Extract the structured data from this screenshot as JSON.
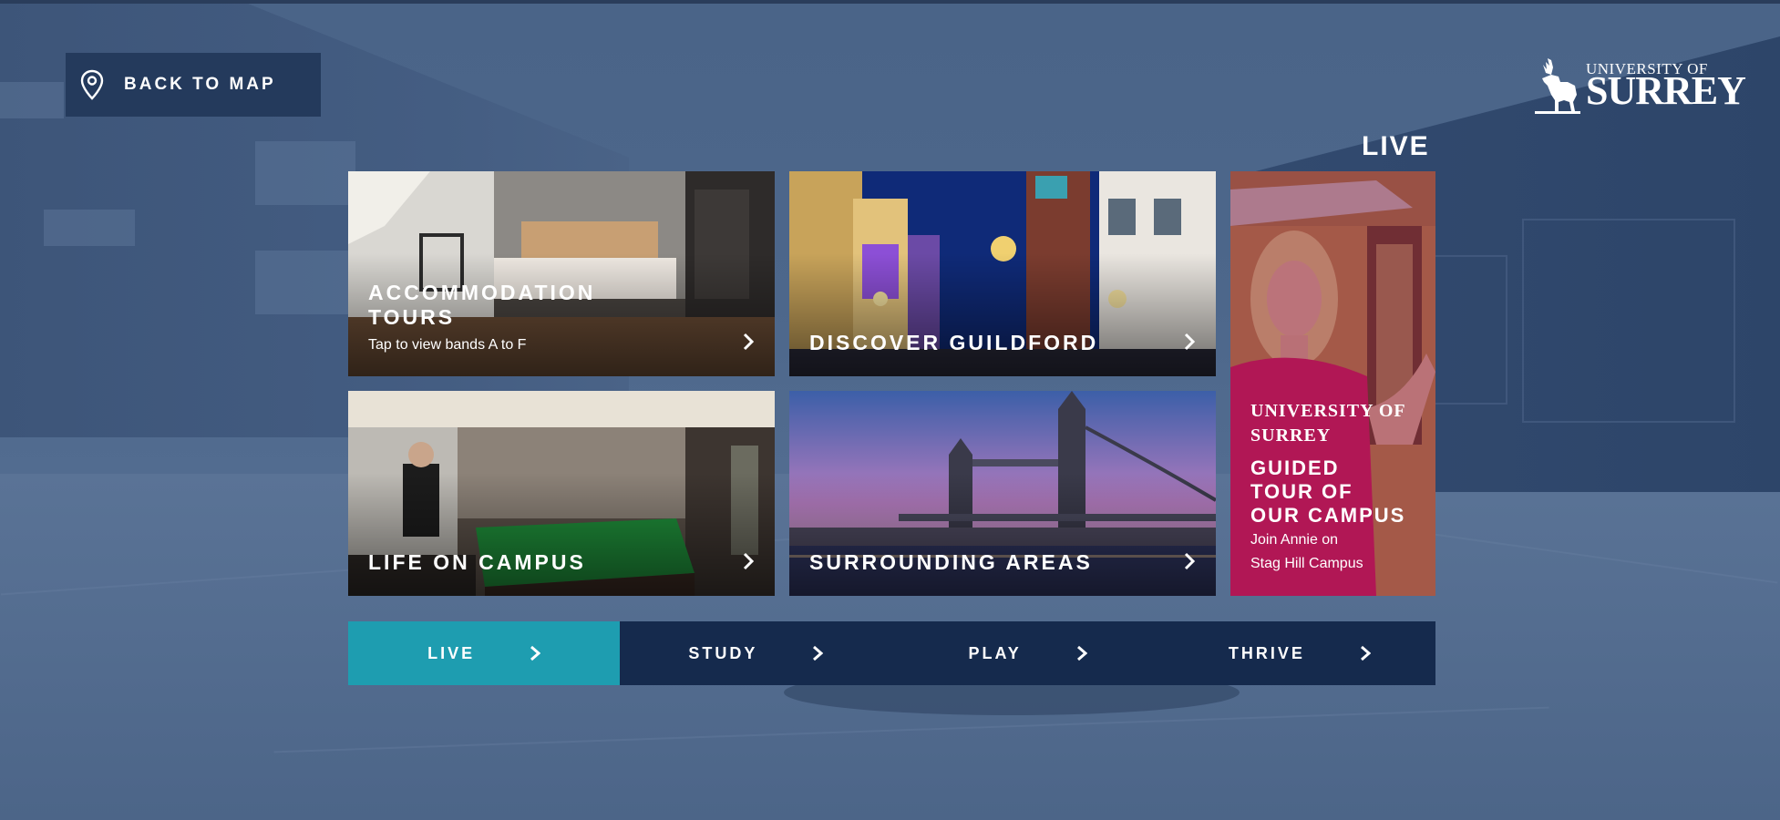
{
  "back_button": {
    "label": "BACK TO MAP",
    "icon": "map-pin-icon"
  },
  "logo": {
    "line1": "UNIVERSITY OF",
    "line2": "SURREY",
    "icon": "stag-icon"
  },
  "section": {
    "title": "LIVE"
  },
  "tiles": [
    {
      "title_line1": "ACCOMMODATION",
      "title_line2": "TOURS",
      "subtitle": "Tap to view bands A to F",
      "icon": "chevron-right-icon"
    },
    {
      "title_line1": "DISCOVER GUILDFORD",
      "icon": "chevron-right-icon"
    },
    {
      "title_line1": "LIFE ON CAMPUS",
      "icon": "chevron-right-icon"
    },
    {
      "title_line1": "SURROUNDING AREAS",
      "icon": "chevron-right-icon"
    },
    {
      "title_line1": "GUIDED",
      "title_line2": "TOUR OF",
      "title_line3": "OUR CAMPUS",
      "subtitle_line1": "Join Annie on",
      "subtitle_line2": "Stag Hill Campus",
      "shirt_text": "UNIVERSITY OF SURREY"
    }
  ],
  "nav": [
    {
      "label": "LIVE",
      "active": true
    },
    {
      "label": "STUDY",
      "active": false
    },
    {
      "label": "PLAY",
      "active": false
    },
    {
      "label": "THRIVE",
      "active": false
    }
  ],
  "colors": {
    "nav_active": "#1e9db0",
    "nav_bg": "#152a4d",
    "back_bg": "#243a5c",
    "tile5_tint": "#b3124f"
  }
}
